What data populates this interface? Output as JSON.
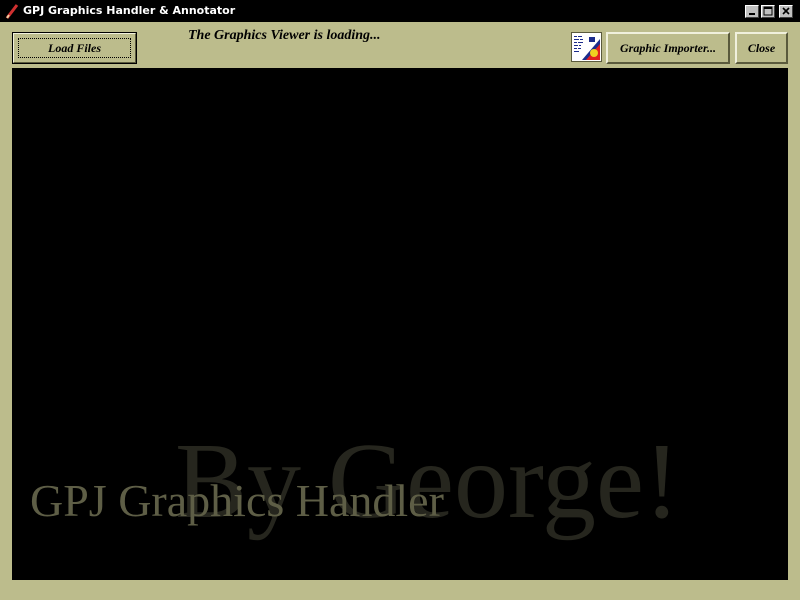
{
  "window": {
    "title": "GPJ Graphics Handler & Annotator",
    "controls": [
      "minimize",
      "maximize",
      "close"
    ]
  },
  "toolbar": {
    "load_files_label": "Load Files",
    "status_text": "The Graphics Viewer is loading...",
    "graphic_importer_label": "Graphic Importer...",
    "close_label": "Close",
    "importer_icon": "image-import-icon"
  },
  "viewer": {
    "watermark_big": "By George!",
    "watermark_small": "GPJ Graphics Handler",
    "background": "#000000"
  },
  "colors": {
    "window_bg": "#bcbc8c",
    "titlebar_bg": "#000000",
    "watermark_big": "#26261e",
    "watermark_small": "#5e5e46"
  }
}
